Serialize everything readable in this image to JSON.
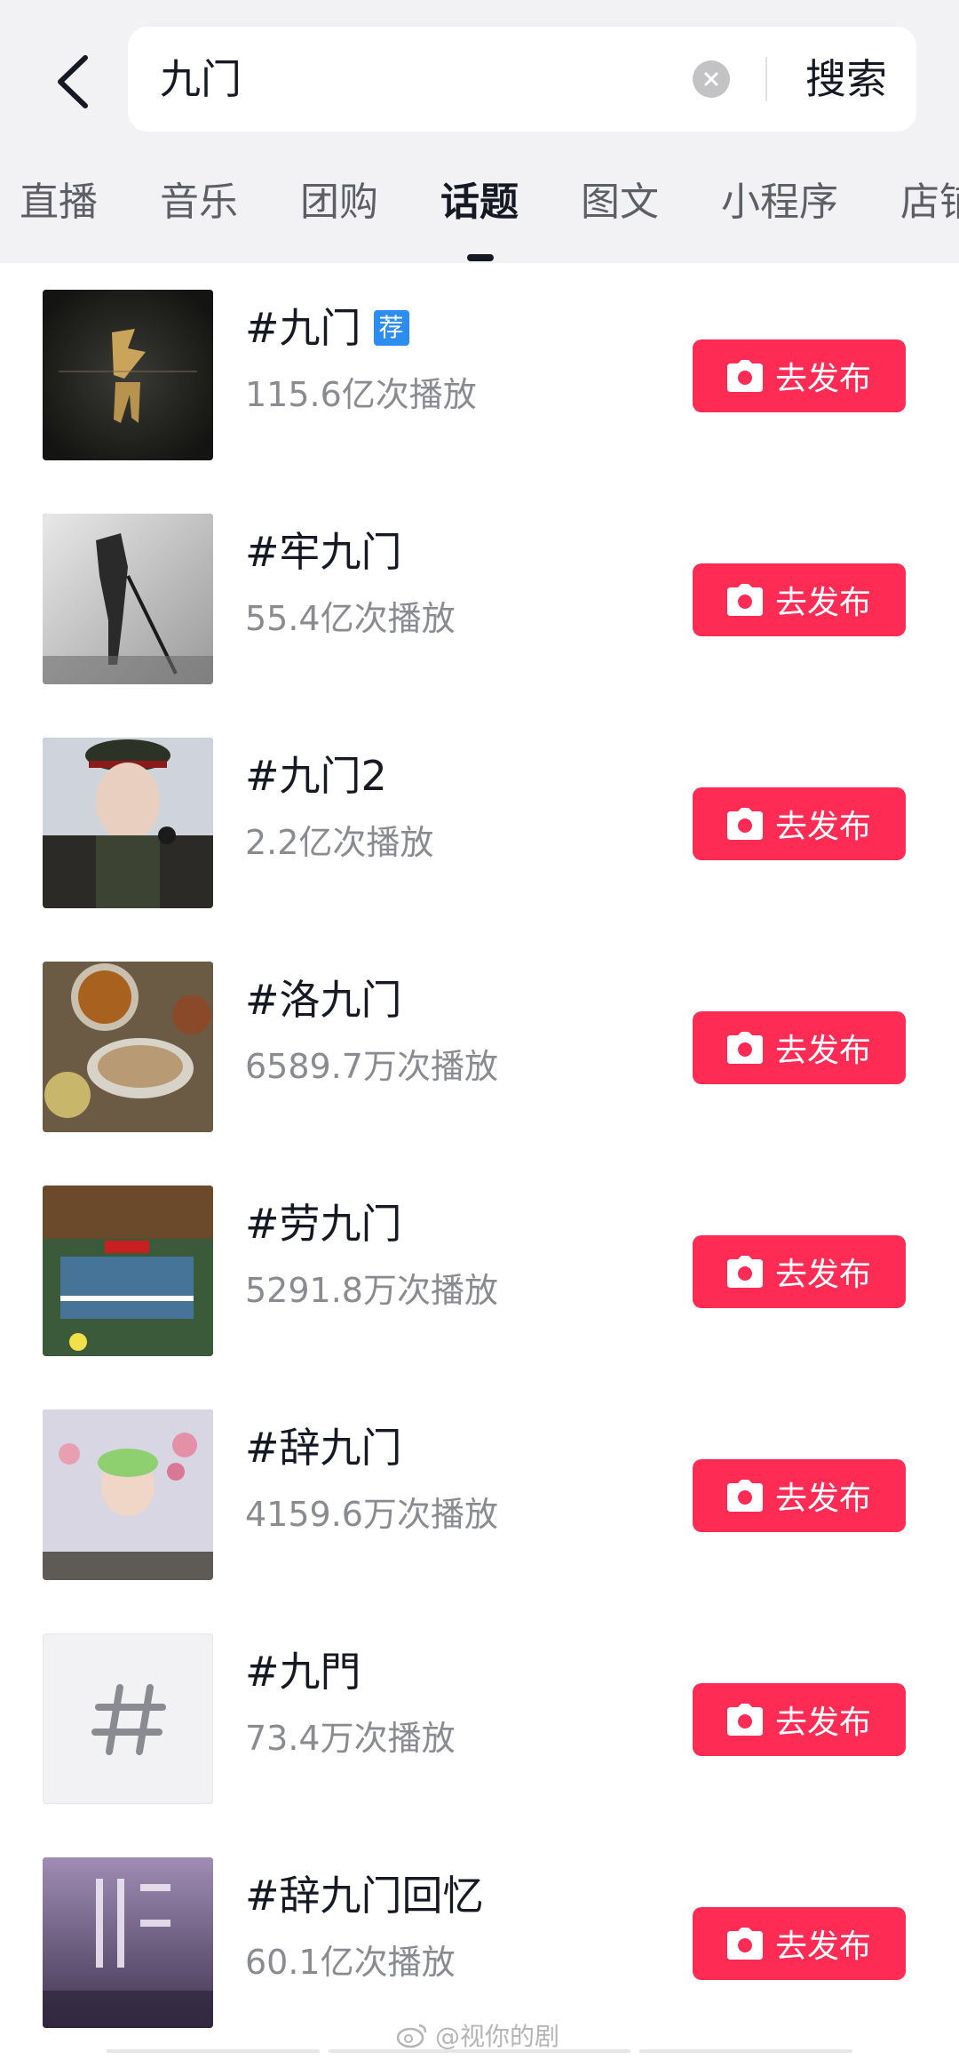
{
  "search": {
    "query": "九门",
    "submit_label": "搜索"
  },
  "tabs": [
    {
      "label": "直播",
      "active": false
    },
    {
      "label": "音乐",
      "active": false
    },
    {
      "label": "团购",
      "active": false
    },
    {
      "label": "话题",
      "active": true
    },
    {
      "label": "图文",
      "active": false
    },
    {
      "label": "小程序",
      "active": false
    },
    {
      "label": "店铺",
      "active": false
    }
  ],
  "topics": [
    {
      "title": "#九门",
      "plays": "115.6亿次播放",
      "badge": "荐",
      "publish_label": "去发布",
      "thumb": "dark-calligraphy"
    },
    {
      "title": "#牢九门",
      "plays": "55.4亿次播放",
      "publish_label": "去发布",
      "thumb": "bw-figure"
    },
    {
      "title": "#九门2",
      "plays": "2.2亿次播放",
      "publish_label": "去发布",
      "thumb": "officer-portrait"
    },
    {
      "title": "#洛九门",
      "plays": "6589.7万次播放",
      "publish_label": "去发布",
      "thumb": "food-table"
    },
    {
      "title": "#劳九门",
      "plays": "5291.8万次播放",
      "publish_label": "去发布",
      "thumb": "game-scene"
    },
    {
      "title": "#辞九门",
      "plays": "4159.6万次播放",
      "publish_label": "去发布",
      "thumb": "blossom-portrait"
    },
    {
      "title": "#九門",
      "plays": "73.4万次播放",
      "publish_label": "去发布",
      "thumb": "hash-placeholder"
    },
    {
      "title": "#辞九门回忆",
      "plays": "60.1亿次播放",
      "publish_label": "去发布",
      "thumb": "purple-poster"
    }
  ],
  "watermark": "@视你的剧",
  "colors": {
    "accent": "#fe2c55",
    "header_bg": "#f2f2f4",
    "badge": "#2d8cf0"
  },
  "icons": {
    "back": "chevron-left-icon",
    "clear": "clear-icon",
    "publish": "camera-icon"
  }
}
